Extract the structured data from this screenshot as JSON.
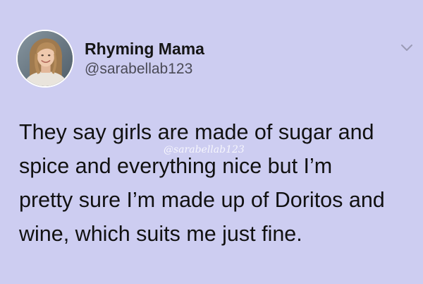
{
  "tweet": {
    "display_name": "Rhyming Mama",
    "handle": "@sarabellab123",
    "avatar_icon": "profile-photo",
    "menu_icon": "chevron-down-icon",
    "text_lines": [
      "They say girls are made of sugar and",
      "spice and everything nice but I’m",
      "pretty sure I’m made up of Doritos and",
      "wine, which suits me just fine."
    ],
    "watermark": "@sarabellab123"
  },
  "colors": {
    "background": "#cdcdf1",
    "text": "#111111",
    "handle": "#4a4a56",
    "chevron": "#9a9ab5"
  }
}
